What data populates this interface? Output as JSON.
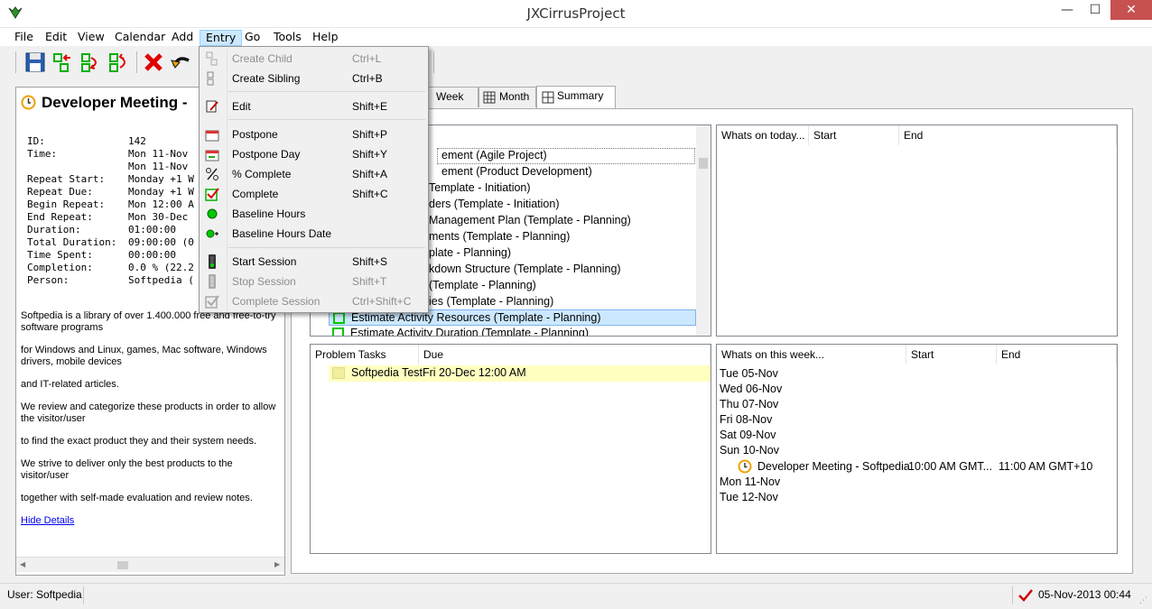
{
  "window": {
    "title": "JXCirrusProject",
    "minimize": "—",
    "maximize": "☐",
    "close": "✕"
  },
  "menu": [
    "File",
    "Edit",
    "View",
    "Calendar",
    "Add",
    "Entry",
    "Go",
    "Tools",
    "Help"
  ],
  "toolbar": {
    "icons": [
      "save-icon",
      "add-child-icon",
      "add-sibling-icon",
      "move-icon",
      "delete-icon",
      "undo-icon"
    ]
  },
  "entry_menu": {
    "items": [
      {
        "label": "Create Child",
        "shortcut": "Ctrl+L",
        "enabled": false,
        "icon": "create-child-icon"
      },
      {
        "label": "Create Sibling",
        "shortcut": "Ctrl+B",
        "enabled": true,
        "icon": "create-sibling-icon"
      },
      {
        "label": "Edit",
        "shortcut": "Shift+E",
        "enabled": true,
        "icon": "edit-icon"
      },
      {
        "label": "Postpone",
        "shortcut": "Shift+P",
        "enabled": true,
        "icon": "postpone-icon"
      },
      {
        "label": "Postpone Day",
        "shortcut": "Shift+Y",
        "enabled": true,
        "icon": "postpone-day-icon"
      },
      {
        "label": "% Complete",
        "shortcut": "Shift+A",
        "enabled": true,
        "icon": "percent-icon"
      },
      {
        "label": "Complete",
        "shortcut": "Shift+C",
        "enabled": true,
        "icon": "check-icon"
      },
      {
        "label": "Baseline Hours",
        "shortcut": "",
        "enabled": true,
        "icon": "green-dot-icon"
      },
      {
        "label": "Baseline Hours Date",
        "shortcut": "",
        "enabled": true,
        "icon": "green-dot-plus-icon"
      },
      {
        "label": "Start Session",
        "shortcut": "Shift+S",
        "enabled": true,
        "icon": "traffic-light-icon"
      },
      {
        "label": "Stop Session",
        "shortcut": "Shift+T",
        "enabled": false,
        "icon": "traffic-light-icon"
      },
      {
        "label": "Complete Session",
        "shortcut": "Ctrl+Shift+C",
        "enabled": false,
        "icon": "check-icon"
      }
    ]
  },
  "details": {
    "title": "Developer Meeting -",
    "fields": [
      {
        "key": "ID:",
        "value": "142"
      },
      {
        "key": "Time:",
        "value": "Mon 11-Nov"
      },
      {
        "key": "",
        "value": "Mon 11-Nov"
      },
      {
        "key": "Repeat Start:",
        "value": "Monday +1 W"
      },
      {
        "key": "Repeat Due:",
        "value": "Monday +1 W"
      },
      {
        "key": "Begin Repeat:",
        "value": "Mon 12:00 A"
      },
      {
        "key": "End Repeat:",
        "value": "Mon 30-Dec"
      },
      {
        "key": "Duration:",
        "value": "01:00:00"
      },
      {
        "key": "Total Duration:",
        "value": "09:00:00 (0"
      },
      {
        "key": "Time Spent:",
        "value": "00:00:00"
      },
      {
        "key": "Completion:",
        "value": "0.0 % (22.2"
      },
      {
        "key": "Person:",
        "value": "Softpedia ("
      }
    ],
    "paragraphs": [
      "Softpedia is a library of over 1.400.000 free and free-to-try software programs",
      "for Windows and Linux, games, Mac software, Windows drivers, mobile devices",
      "and IT-related articles.",
      "We review and categorize these products in order to allow the visitor/user",
      "to find the exact product they and their system needs.",
      "We strive to deliver only the best products to the visitor/user",
      "together with self-made evaluation and review notes."
    ],
    "hide_link": "Hide Details"
  },
  "tabs": [
    {
      "label": "Week",
      "selected": false
    },
    {
      "label": "Month",
      "selected": false
    },
    {
      "label": "Summary",
      "selected": true
    }
  ],
  "task_list": {
    "items": [
      "ement (Agile Project)",
      "ement (Product Development)",
      "Template - Initiation)",
      "ders (Template - Initiation)",
      "Management Plan (Template - Planning)",
      "ments (Template - Planning)",
      "plate - Planning)",
      "kdown Structure (Template - Planning)",
      "(Template - Planning)",
      "ies (Template - Planning)",
      "Estimate Activity Resources (Template - Planning)",
      "Estimate Activity Duration (Template - Planning)"
    ]
  },
  "today": {
    "headers": [
      "Whats on today...",
      "Start",
      "End"
    ]
  },
  "problem_tasks": {
    "headers": [
      "Problem Tasks",
      "Due"
    ],
    "rows": [
      {
        "task": "Softpedia Test",
        "due": "Fri 20-Dec 12:00 AM"
      }
    ]
  },
  "week": {
    "headers": [
      "Whats on this week...",
      "Start",
      "End"
    ],
    "days": [
      "Tue 05-Nov",
      "Wed 06-Nov",
      "Thu 07-Nov",
      "Fri 08-Nov",
      "Sat 09-Nov",
      "Sun 10-Nov"
    ],
    "event": {
      "title": "Developer Meeting - Softpedia",
      "start": "10:00 AM GMT...",
      "end": "11:00 AM GMT+10"
    },
    "days_after": [
      "Mon 11-Nov",
      "Tue 12-Nov"
    ]
  },
  "status": {
    "user": "User: Softpedia",
    "datetime": "05-Nov-2013 00:44"
  },
  "colors": {
    "accent": "#cce8ff",
    "highlight_row": "#ffffc0",
    "green": "#00c800",
    "clock": "#f0a000"
  }
}
